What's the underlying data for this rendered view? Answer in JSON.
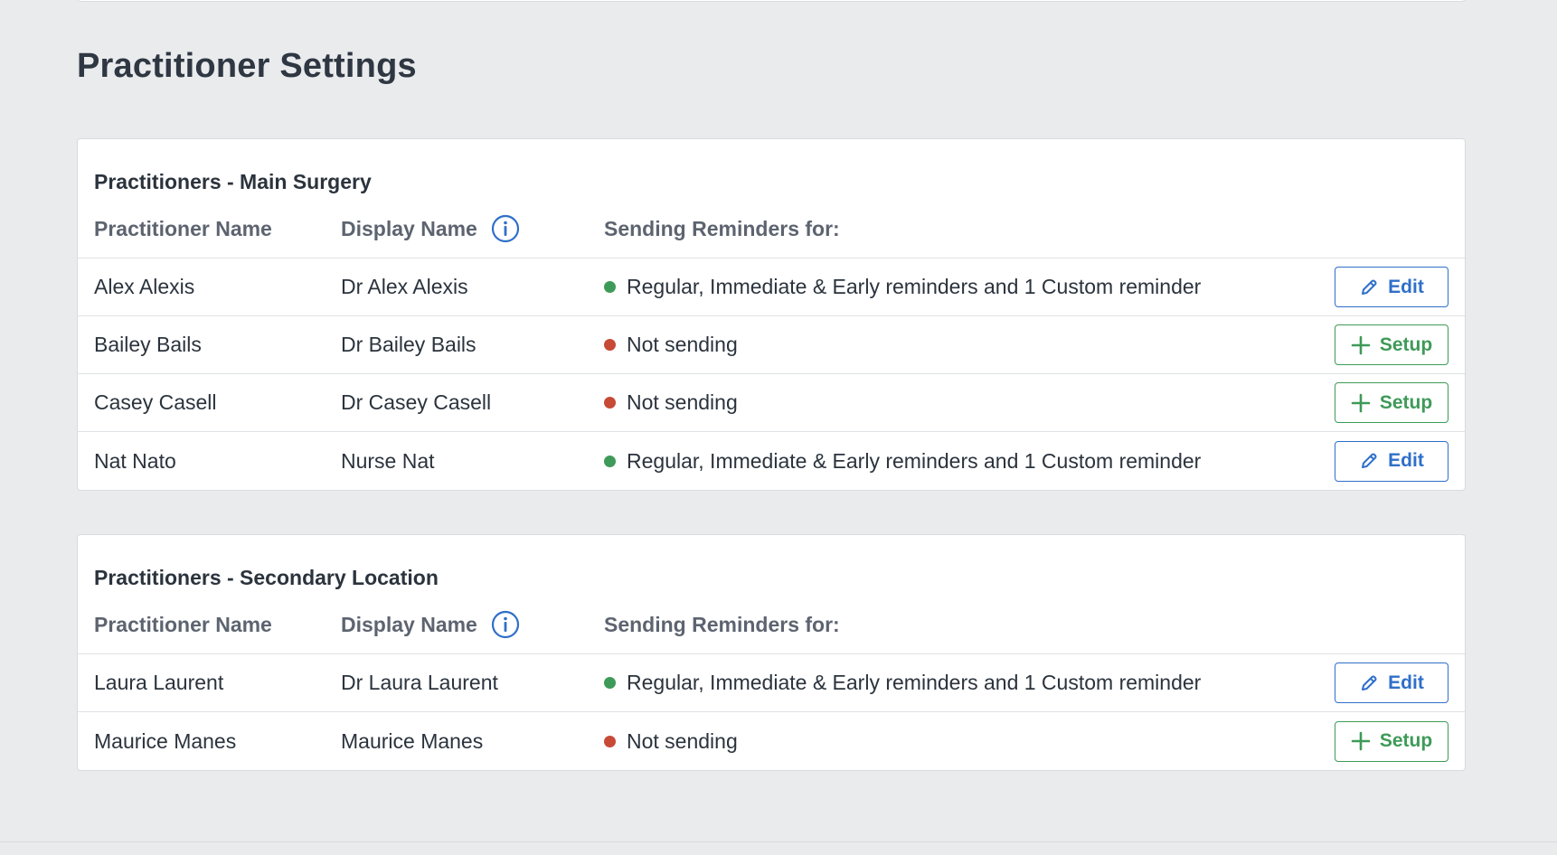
{
  "page": {
    "title": "Practitioner Settings"
  },
  "colors": {
    "background": "#e9ebed",
    "edit_blue": "#2f6fc9",
    "setup_green": "#3e9a58",
    "status_sending": "#3e9a58",
    "status_not_sending": "#c64a35"
  },
  "columns": {
    "practitioner_name": "Practitioner Name",
    "display_name": "Display Name",
    "sending_reminders": "Sending Reminders for:"
  },
  "icons": {
    "info": "info-icon",
    "edit": "pencil-icon",
    "setup": "plus-icon"
  },
  "buttons": {
    "edit_label": "Edit",
    "setup_label": "Setup"
  },
  "sections": [
    {
      "title": "Practitioners - Main Surgery",
      "rows": [
        {
          "name": "Alex Alexis",
          "display": "Dr Alex Alexis",
          "status": "sending",
          "status_text": "Regular, Immediate & Early reminders and 1 Custom reminder",
          "action": "edit"
        },
        {
          "name": "Bailey Bails",
          "display": "Dr Bailey Bails",
          "status": "not-sending",
          "status_text": "Not sending",
          "action": "setup"
        },
        {
          "name": "Casey Casell",
          "display": "Dr Casey Casell",
          "status": "not-sending",
          "status_text": "Not sending",
          "action": "setup"
        },
        {
          "name": "Nat Nato",
          "display": "Nurse Nat",
          "status": "sending",
          "status_text": "Regular, Immediate & Early reminders and 1 Custom reminder",
          "action": "edit"
        }
      ]
    },
    {
      "title": "Practitioners - Secondary Location",
      "rows": [
        {
          "name": "Laura Laurent",
          "display": "Dr Laura Laurent",
          "status": "sending",
          "status_text": "Regular, Immediate & Early reminders and 1 Custom reminder",
          "action": "edit"
        },
        {
          "name": "Maurice Manes",
          "display": "Maurice Manes",
          "status": "not-sending",
          "status_text": "Not sending",
          "action": "setup"
        }
      ]
    }
  ]
}
